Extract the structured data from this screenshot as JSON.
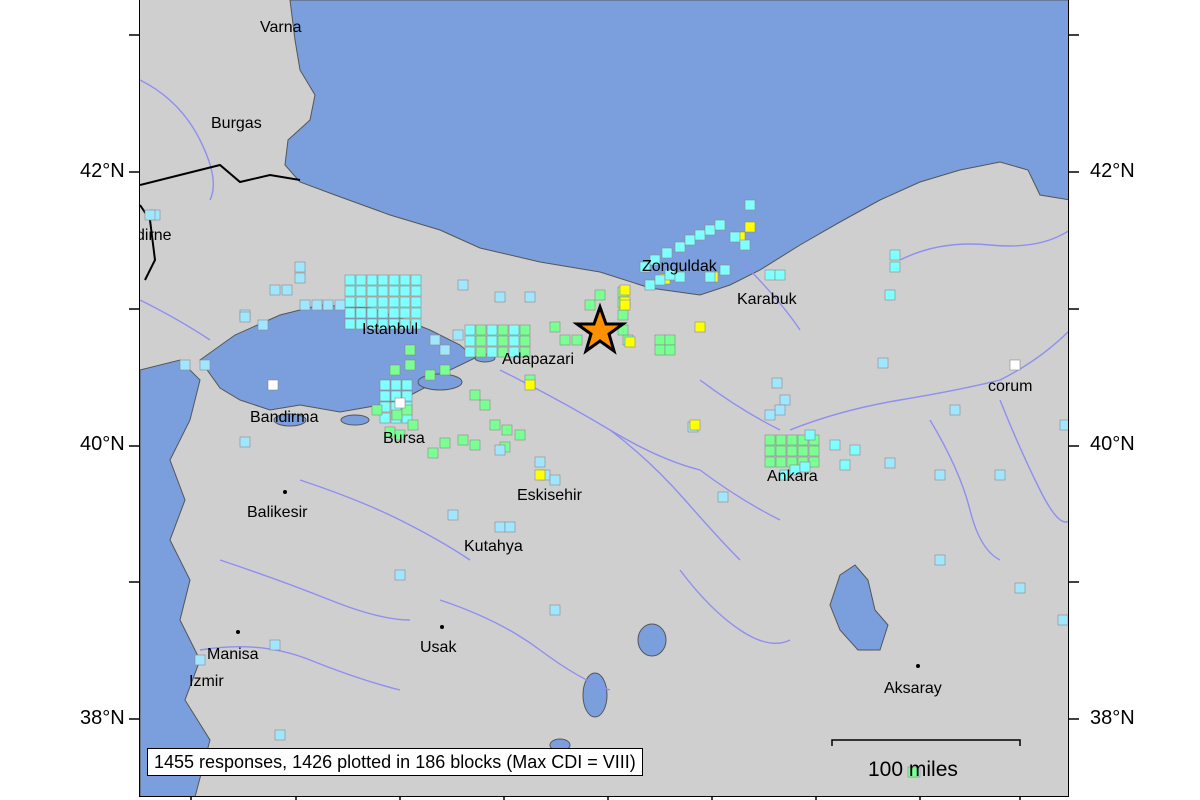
{
  "map": {
    "latitude_labels": {
      "lat_42": "42°N",
      "lat_40": "40°N",
      "lat_38": "38°N"
    },
    "cities": [
      {
        "name": "Varna"
      },
      {
        "name": "Burgas"
      },
      {
        "name": "dirne"
      },
      {
        "name": "Istanbul"
      },
      {
        "name": "Adapazari"
      },
      {
        "name": "Zonguldak"
      },
      {
        "name": "Karabuk"
      },
      {
        "name": "corum"
      },
      {
        "name": "Bandirma"
      },
      {
        "name": "Bursa"
      },
      {
        "name": "Balikesir"
      },
      {
        "name": "Eskisehir"
      },
      {
        "name": "Kutahya"
      },
      {
        "name": "Ankara"
      },
      {
        "name": "Manisa"
      },
      {
        "name": "Izmir"
      },
      {
        "name": "Usak"
      },
      {
        "name": "Aksaray"
      }
    ],
    "epicenter": {
      "symbol": "star-icon"
    },
    "caption": "1455 responses, 1426 plotted in 186 blocks (Max CDI = VIII)",
    "scale_bar_label": "100 miles",
    "colors": {
      "sea": "#7a9fdc",
      "land": "#cfcfcf",
      "river": "#8f8ff0",
      "cdi_II": "#bfccff",
      "cdi_III": "#a0e6ff",
      "cdi_IV": "#80ffff",
      "cdi_V": "#7aff93",
      "cdi_VI": "#ffff00",
      "cdi_VII": "#ffc800",
      "cdi_VIII": "#ff9100",
      "no_data": "#ffffff"
    }
  }
}
